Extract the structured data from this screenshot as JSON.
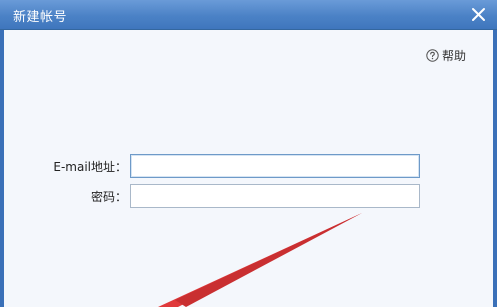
{
  "window": {
    "title": "新建帐号"
  },
  "help": {
    "label": "帮助"
  },
  "form": {
    "email": {
      "label": "E-mail地址：",
      "value": "",
      "placeholder": ""
    },
    "password": {
      "label": "密码：",
      "value": "",
      "placeholder": ""
    }
  },
  "colors": {
    "titlebar": "#4b82c6",
    "body_bg": "#f4f7fc",
    "arrow": "#e0393b"
  },
  "icons": {
    "close": "close-icon",
    "help": "help-icon"
  }
}
